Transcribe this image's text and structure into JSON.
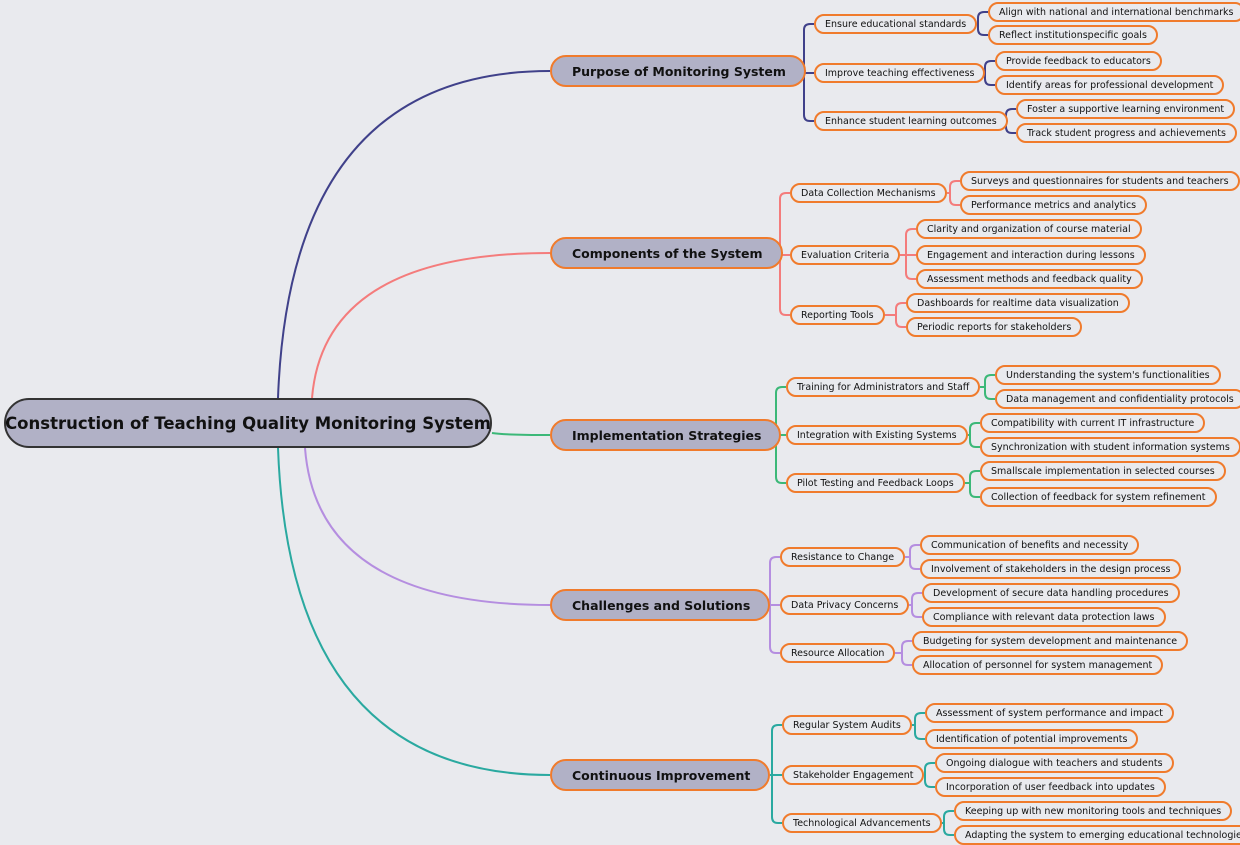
{
  "colors": {
    "node_border": "#f07b2c",
    "branch_fill": "#b1b1c6",
    "background": "#e9eaee"
  },
  "root": {
    "label": "Construction of Teaching Quality Monitoring System"
  },
  "branches": [
    {
      "label": "Purpose of Monitoring System",
      "color": "#40418a",
      "children": [
        {
          "label": "Ensure educational standards",
          "children": [
            "Align with national and international benchmarks",
            "Reflect institutionspecific goals"
          ]
        },
        {
          "label": "Improve teaching effectiveness",
          "children": [
            "Provide feedback to educators",
            "Identify areas for professional development"
          ]
        },
        {
          "label": "Enhance student learning outcomes",
          "children": [
            "Foster a supportive learning environment",
            "Track student progress and achievements"
          ]
        }
      ]
    },
    {
      "label": "Components of the System",
      "color": "#f47c7c",
      "children": [
        {
          "label": "Data Collection Mechanisms",
          "children": [
            "Surveys and questionnaires for students and teachers",
            "Performance metrics and analytics"
          ]
        },
        {
          "label": "Evaluation Criteria",
          "children": [
            "Clarity and organization of course material",
            "Engagement and interaction during lessons",
            "Assessment methods and feedback quality"
          ]
        },
        {
          "label": "Reporting Tools",
          "children": [
            "Dashboards for realtime data visualization",
            "Periodic reports for stakeholders"
          ]
        }
      ]
    },
    {
      "label": "Implementation Strategies",
      "color": "#3cb878",
      "children": [
        {
          "label": "Training for Administrators and Staff",
          "children": [
            "Understanding the system's functionalities",
            "Data management and confidentiality protocols"
          ]
        },
        {
          "label": "Integration with Existing Systems",
          "children": [
            "Compatibility with current IT infrastructure",
            "Synchronization with student information systems"
          ]
        },
        {
          "label": "Pilot Testing and Feedback Loops",
          "children": [
            "Smallscale implementation in selected courses",
            "Collection of feedback for system refinement"
          ]
        }
      ]
    },
    {
      "label": "Challenges and Solutions",
      "color": "#b58ee0",
      "children": [
        {
          "label": "Resistance to Change",
          "children": [
            "Communication of benefits and necessity",
            "Involvement of stakeholders in the design process"
          ]
        },
        {
          "label": "Data Privacy Concerns",
          "children": [
            "Development of secure data handling procedures",
            "Compliance with relevant data protection laws"
          ]
        },
        {
          "label": "Resource Allocation",
          "children": [
            "Budgeting for system development and maintenance",
            "Allocation of personnel for system management"
          ]
        }
      ]
    },
    {
      "label": "Continuous Improvement",
      "color": "#2aa9a0",
      "children": [
        {
          "label": "Regular System Audits",
          "children": [
            "Assessment of system performance and impact",
            "Identification of potential improvements"
          ]
        },
        {
          "label": "Stakeholder Engagement",
          "children": [
            "Ongoing dialogue with teachers and students",
            "Incorporation of user feedback into updates"
          ]
        },
        {
          "label": "Technological Advancements",
          "children": [
            "Keeping up with new monitoring tools and techniques",
            "Adapting the system to emerging educational technologies"
          ]
        }
      ]
    }
  ]
}
